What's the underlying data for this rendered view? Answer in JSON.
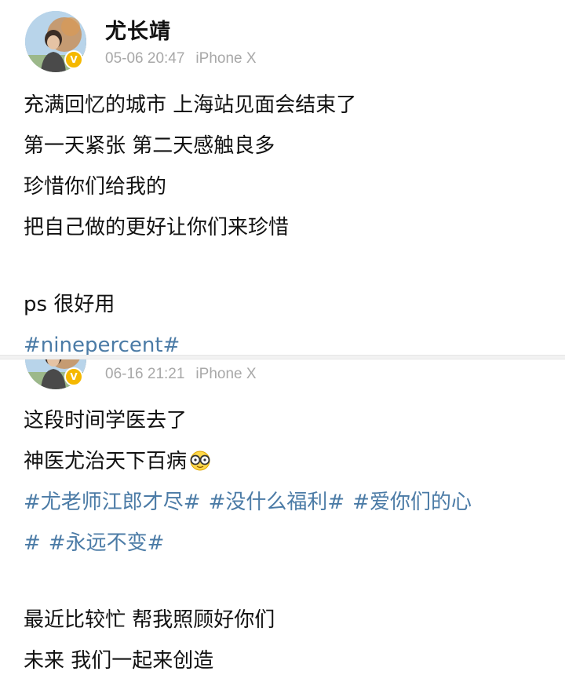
{
  "post1": {
    "username": "尤长靖",
    "time": "05-06 20:47",
    "source": "iPhone X",
    "lines": [
      "充满回忆的城市 上海站见面会结束了",
      "第一天紧张 第二天感触良多",
      "珍惜你们给我的",
      "把自己做的更好让你们来珍惜"
    ],
    "ps_line": "ps 很好用",
    "hashtag": "#ninepercent#"
  },
  "post2": {
    "time": "06-16 21:21",
    "source": "iPhone X",
    "line1": "这段时间学医去了",
    "line2": "神医尤治天下百病",
    "emoji": "nerd-glasses-emoji",
    "hashtags_row1": [
      "#尤老师江郎才尽#",
      "#没什么福利#",
      "#爱你们的心"
    ],
    "hashtags_row2": [
      "#",
      "#永远不变#"
    ],
    "line3": "最近比较忙 帮我照顾好你们",
    "line4": "未来 我们一起来创造"
  },
  "colors": {
    "hashtag": "#4b7ba6",
    "meta": "#a8a8a8",
    "badge": "#f5b800"
  }
}
